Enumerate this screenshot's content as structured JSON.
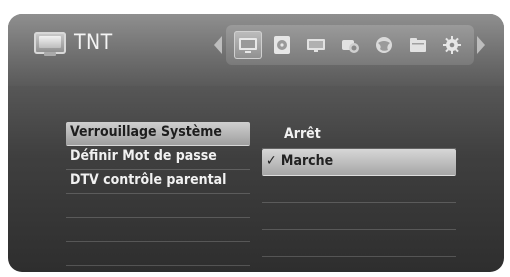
{
  "app": {
    "title": "TNT"
  },
  "toolbar": {
    "icons": [
      {
        "name": "tv-icon",
        "active": true
      },
      {
        "name": "disc-icon",
        "active": false
      },
      {
        "name": "monitor-icon",
        "active": false
      },
      {
        "name": "camera-icon",
        "active": false
      },
      {
        "name": "globe-icon",
        "active": false
      },
      {
        "name": "folder-icon",
        "active": false
      },
      {
        "name": "gear-icon",
        "active": false
      }
    ]
  },
  "menu": {
    "items": [
      {
        "label": "Verrouillage Système",
        "selected": true
      },
      {
        "label": "Définir Mot de passe",
        "selected": false
      },
      {
        "label": "DTV contrôle parental",
        "selected": false
      }
    ]
  },
  "options": {
    "items": [
      {
        "label": "Arrêt",
        "selected": false
      },
      {
        "label": "✓ Marche",
        "selected": true
      }
    ]
  },
  "colors": {
    "panel_dark": "#2e2e2e",
    "highlight": "#cfcfcf",
    "text": "#f1f1f1"
  }
}
